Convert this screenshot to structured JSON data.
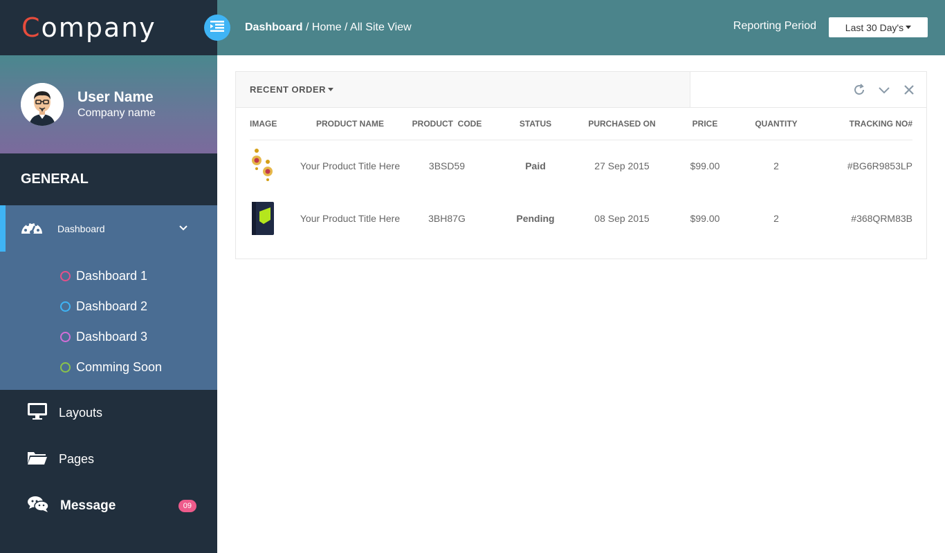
{
  "brand": {
    "logo_first": "C",
    "logo_rest": "ompany",
    "accent": "#e74c3c"
  },
  "profile": {
    "user_name": "User Name",
    "company_name": "Company name"
  },
  "sidebar": {
    "section_title": "GENERAL",
    "active_item": {
      "label": "Dashboard",
      "icon": "dashboard-gauge-icon"
    },
    "submenu": [
      {
        "label": "Dashboard 1",
        "ring_color": "#e5508a"
      },
      {
        "label": "Dashboard 2",
        "ring_color": "#3fb4f5"
      },
      {
        "label": "Dashboard 3",
        "ring_color": "#d46ed8"
      },
      {
        "label": "Comming Soon",
        "ring_color": "#8bc34a"
      }
    ],
    "items": [
      {
        "label": "Layouts",
        "icon": "monitor-icon"
      },
      {
        "label": "Pages",
        "icon": "folder-open-icon"
      },
      {
        "label": "Message",
        "icon": "chat-icon",
        "badge": "09"
      }
    ]
  },
  "topbar": {
    "breadcrumb_root": "Dashboard",
    "breadcrumb_rest": " / Home / All Site View",
    "reporting_label": "Reporting Period",
    "period_value": "Last 30 Day's"
  },
  "panel": {
    "title": "RECENT ORDER",
    "columns": [
      "IMAGE",
      "PRODUCT NAME",
      "PRODUCT  CODE",
      "STATUS",
      "PURCHASED ON",
      "PRICE",
      "QUANTITY",
      "TRACKING NO#"
    ],
    "rows": [
      {
        "image": "earrings-product-image",
        "name": "Your Product Title Here",
        "code": "3BSD59",
        "status": "Paid",
        "purchased": "27 Sep 2015",
        "price": "$99.00",
        "quantity": "2",
        "tracking": "#BG6R9853LP"
      },
      {
        "image": "phone-case-product-image",
        "name": "Your Product Title Here",
        "code": "3BH87G",
        "status": "Pending",
        "purchased": "08 Sep 2015",
        "price": "$99.00",
        "quantity": "2",
        "tracking": "#368QRM83B"
      }
    ]
  },
  "colors": {
    "sidebar_bg": "#212f3d",
    "topbar_bg": "#4b848b",
    "active_bg": "#4a6d93",
    "active_marker": "#3fb4f5",
    "badge": "#ee5b8b"
  }
}
